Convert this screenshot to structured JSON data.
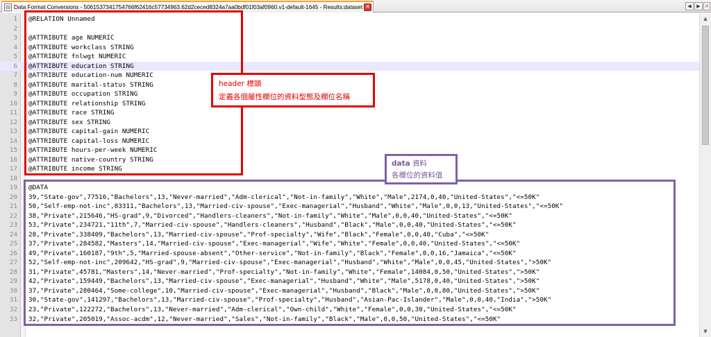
{
  "tab": {
    "title": "Data Format Conversions - 5061537341754766f62416c57734963.62d2ceced8324a7aa0bdf01f03af0960.v1-default-1645 - Results:dataset.arff",
    "close_glyph": "×",
    "nav_left": "◀",
    "nav_right": "▶",
    "nav_close": "×"
  },
  "scrollbar": {
    "up": "▲",
    "down": "▼"
  },
  "editor": {
    "current_line": 6,
    "lines": [
      {
        "n": "1",
        "text": "@RELATION Unnamed"
      },
      {
        "n": "2",
        "text": ""
      },
      {
        "n": "3",
        "text": "@ATTRIBUTE age NUMERIC"
      },
      {
        "n": "4",
        "text": "@ATTRIBUTE workclass STRING"
      },
      {
        "n": "5",
        "text": "@ATTRIBUTE fnlwgt NUMERIC"
      },
      {
        "n": "6",
        "text": "@ATTRIBUTE education STRING"
      },
      {
        "n": "7",
        "text": "@ATTRIBUTE education-num NUMERIC"
      },
      {
        "n": "8",
        "text": "@ATTRIBUTE marital-status STRING"
      },
      {
        "n": "9",
        "text": "@ATTRIBUTE occupation STRING"
      },
      {
        "n": "10",
        "text": "@ATTRIBUTE relationship STRING"
      },
      {
        "n": "11",
        "text": "@ATTRIBUTE race STRING"
      },
      {
        "n": "12",
        "text": "@ATTRIBUTE sex STRING"
      },
      {
        "n": "13",
        "text": "@ATTRIBUTE capital-gain NUMERIC"
      },
      {
        "n": "14",
        "text": "@ATTRIBUTE capital-loss NUMERIC"
      },
      {
        "n": "15",
        "text": "@ATTRIBUTE hours-per-week NUMERIC"
      },
      {
        "n": "16",
        "text": "@ATTRIBUTE native-country STRING"
      },
      {
        "n": "17",
        "text": "@ATTRIBUTE income STRING"
      },
      {
        "n": "18",
        "text": ""
      },
      {
        "n": "19",
        "text": "@DATA"
      },
      {
        "n": "20",
        "text": "39,\"State-gov\",77516,\"Bachelors\",13,\"Never-married\",\"Adm-clerical\",\"Not-in-family\",\"White\",\"Male\",2174,0,40,\"United-States\",\"<=50K\""
      },
      {
        "n": "21",
        "text": "50,\"Self-emp-not-inc\",83311,\"Bachelors\",13,\"Married-civ-spouse\",\"Exec-managerial\",\"Husband\",\"White\",\"Male\",0,0,13,\"United-States\",\"<=50K\""
      },
      {
        "n": "22",
        "text": "38,\"Private\",215646,\"HS-grad\",9,\"Divorced\",\"Handlers-cleaners\",\"Not-in-family\",\"White\",\"Male\",0,0,40,\"United-States\",\"<=50K\""
      },
      {
        "n": "23",
        "text": "53,\"Private\",234721,\"11th\",7,\"Married-civ-spouse\",\"Handlers-cleaners\",\"Husband\",\"Black\",\"Male\",0,0,40,\"United-States\",\"<=50K\""
      },
      {
        "n": "24",
        "text": "28,\"Private\",338409,\"Bachelors\",13,\"Married-civ-spouse\",\"Prof-specialty\",\"Wife\",\"Black\",\"Female\",0,0,40,\"Cuba\",\"<=50K\""
      },
      {
        "n": "25",
        "text": "37,\"Private\",284582,\"Masters\",14,\"Married-civ-spouse\",\"Exec-managerial\",\"Wife\",\"White\",\"Female\",0,0,40,\"United-States\",\"<=50K\""
      },
      {
        "n": "26",
        "text": "49,\"Private\",160187,\"9th\",5,\"Married-spouse-absent\",\"Other-service\",\"Not-in-family\",\"Black\",\"Female\",0,0,16,\"Jamaica\",\"<=50K\""
      },
      {
        "n": "27",
        "text": "52,\"Self-emp-not-inc\",209642,\"HS-grad\",9,\"Married-civ-spouse\",\"Exec-managerial\",\"Husband\",\"White\",\"Male\",0,0,45,\"United-States\",\">50K\""
      },
      {
        "n": "28",
        "text": "31,\"Private\",45781,\"Masters\",14,\"Never-married\",\"Prof-specialty\",\"Not-in-family\",\"White\",\"Female\",14084,0,50,\"United-States\",\">50K\""
      },
      {
        "n": "29",
        "text": "42,\"Private\",159449,\"Bachelors\",13,\"Married-civ-spouse\",\"Exec-managerial\",\"Husband\",\"White\",\"Male\",5178,0,40,\"United-States\",\">50K\""
      },
      {
        "n": "30",
        "text": "37,\"Private\",280464,\"Some-college\",10,\"Married-civ-spouse\",\"Exec-managerial\",\"Husband\",\"Black\",\"Male\",0,0,80,\"United-States\",\">50K\""
      },
      {
        "n": "31",
        "text": "30,\"State-gov\",141297,\"Bachelors\",13,\"Married-civ-spouse\",\"Prof-specialty\",\"Husband\",\"Asian-Pac-Islander\",\"Male\",0,0,40,\"India\",\">50K\""
      },
      {
        "n": "32",
        "text": "23,\"Private\",122272,\"Bachelors\",13,\"Never-married\",\"Adm-clerical\",\"Own-child\",\"White\",\"Female\",0,0,30,\"United-States\",\"<=50K\""
      },
      {
        "n": "33",
        "text": "32,\"Private\",205019,\"Assoc-acdm\",12,\"Never-married\",\"Sales\",\"Not-in-family\",\"Black\",\"Male\",0,0,50,\"United-States\",\"<=50K\""
      }
    ]
  },
  "annotations": {
    "header_label_en": "header",
    "header_label_zh": " 標頭",
    "header_desc": "定義各個屬性欄位的資料型態及欄位名稱",
    "data_label_en": "data",
    "data_label_zh": " 資料",
    "data_desc": "各欄位的資料值",
    "header_color": "#e60000",
    "data_color": "#8061a3"
  }
}
